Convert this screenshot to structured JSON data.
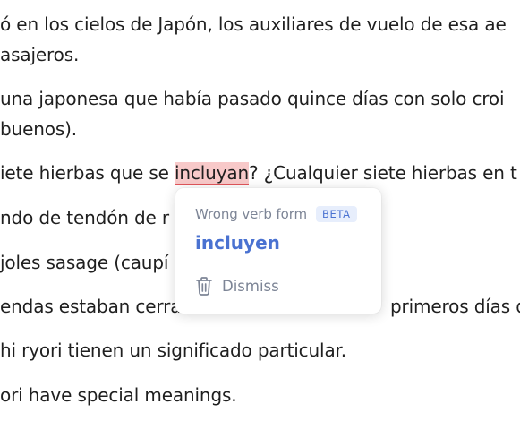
{
  "document": {
    "lines": [
      "ó en los cielos de Japón, los auxiliares de vuelo de esa ae",
      "asajeros.",
      "una japonesa que había pasado quince días con solo croi",
      "buenos).",
      "",
      "ndo de tendón de r",
      "joles sasage (caupí",
      "endas estaban cerra",
      "hi ryori tienen un significado particular.",
      "ori have special meanings."
    ],
    "line5": {
      "before": "iete hierbas que se ",
      "flagged_word": "incluyan",
      "after": "? ¿Cualquier siete hierbas en t"
    },
    "line8_tail": "primeros días del"
  },
  "popup": {
    "error_type": "Wrong verb form",
    "badge": "BETA",
    "suggestion": "incluyen",
    "dismiss_label": "Dismiss",
    "dismiss_icon": "trash-icon"
  },
  "colors": {
    "accent": "#4a72d1",
    "error_highlight": "#f8c9c9",
    "error_underline": "#e0565b",
    "muted_text": "#7d8596"
  }
}
